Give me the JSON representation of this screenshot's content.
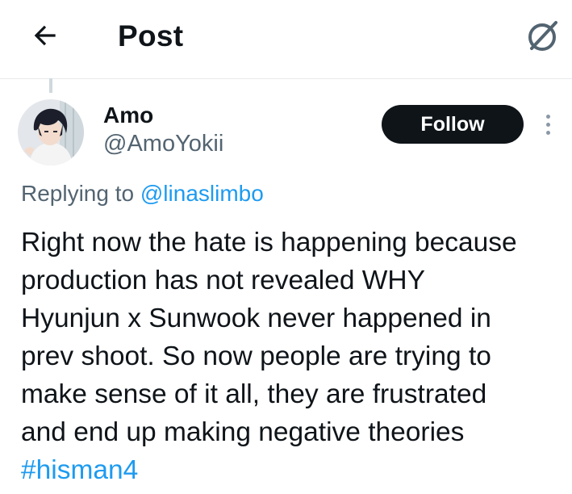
{
  "header": {
    "title": "Post",
    "back_icon": "arrow-left-icon",
    "grok_icon": "grok-icon"
  },
  "author": {
    "name": "Amo",
    "handle": "@AmoYokii",
    "follow_label": "Follow"
  },
  "reply": {
    "prefix": "Replying to",
    "mention": "@linaslimbo"
  },
  "tweet": {
    "lines": [
      "Right now the hate is happening because",
      "production has not revealed WHY",
      "Hyunjun x Sunwook never happened in",
      "prev shoot. So now people are trying to",
      "make sense of it all, they are frustrated",
      "and end up making negative theories"
    ],
    "hashtag": "#hisman4"
  },
  "colors": {
    "link": "#1d9bf0",
    "text": "#0f1419",
    "secondary": "#536471",
    "button": "#0f1419"
  }
}
